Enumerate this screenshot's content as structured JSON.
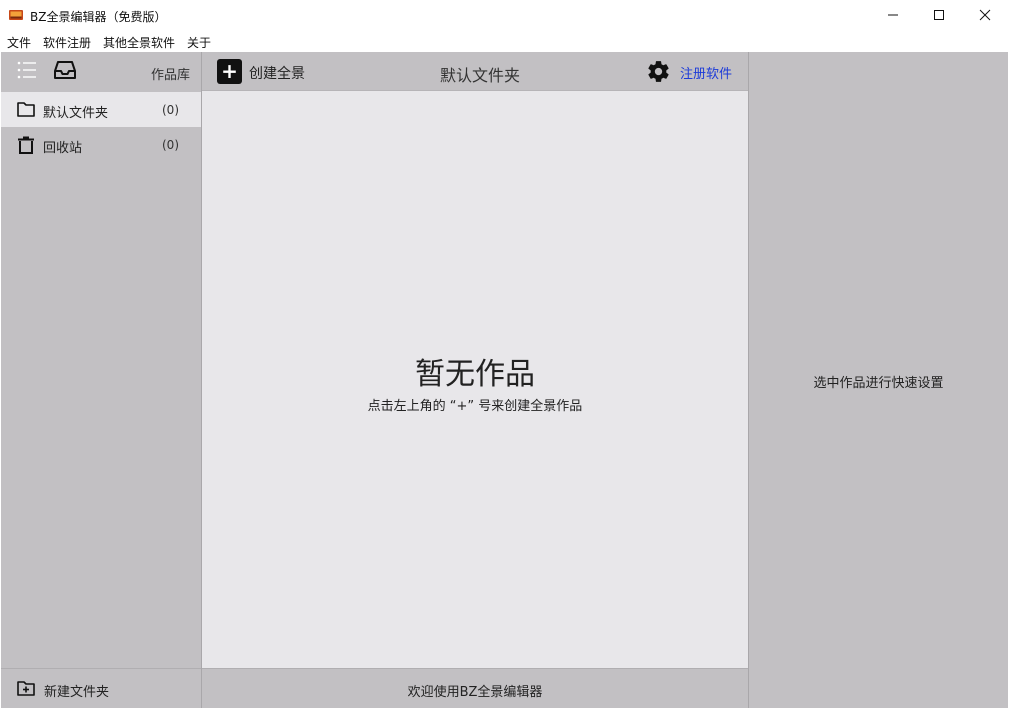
{
  "window": {
    "title": "BZ全景编辑器（免费版）"
  },
  "menu": [
    "文件",
    "软件注册",
    "其他全景软件",
    "关于"
  ],
  "sidebar": {
    "library_label": "作品库",
    "folders": [
      {
        "label": "默认文件夹",
        "count": "(0)",
        "icon": "folder-icon"
      },
      {
        "label": "回收站",
        "count": "(0)",
        "icon": "trash-icon"
      }
    ],
    "new_folder_label": "新建文件夹"
  },
  "main": {
    "create_label": "创建全景",
    "folder_title": "默认文件夹",
    "register_label": "注册软件",
    "empty_title": "暂无作品",
    "empty_hint": "点击左上角的 “+” 号来创建全景作品",
    "footer": "欢迎使用BZ全景编辑器",
    "plus_symbol": "+"
  },
  "right_panel": {
    "hint": "选中作品进行快速设置"
  },
  "colors": {
    "panel": "#c2c0c3",
    "content": "#e8e7ea",
    "link": "#1d3bd8"
  }
}
